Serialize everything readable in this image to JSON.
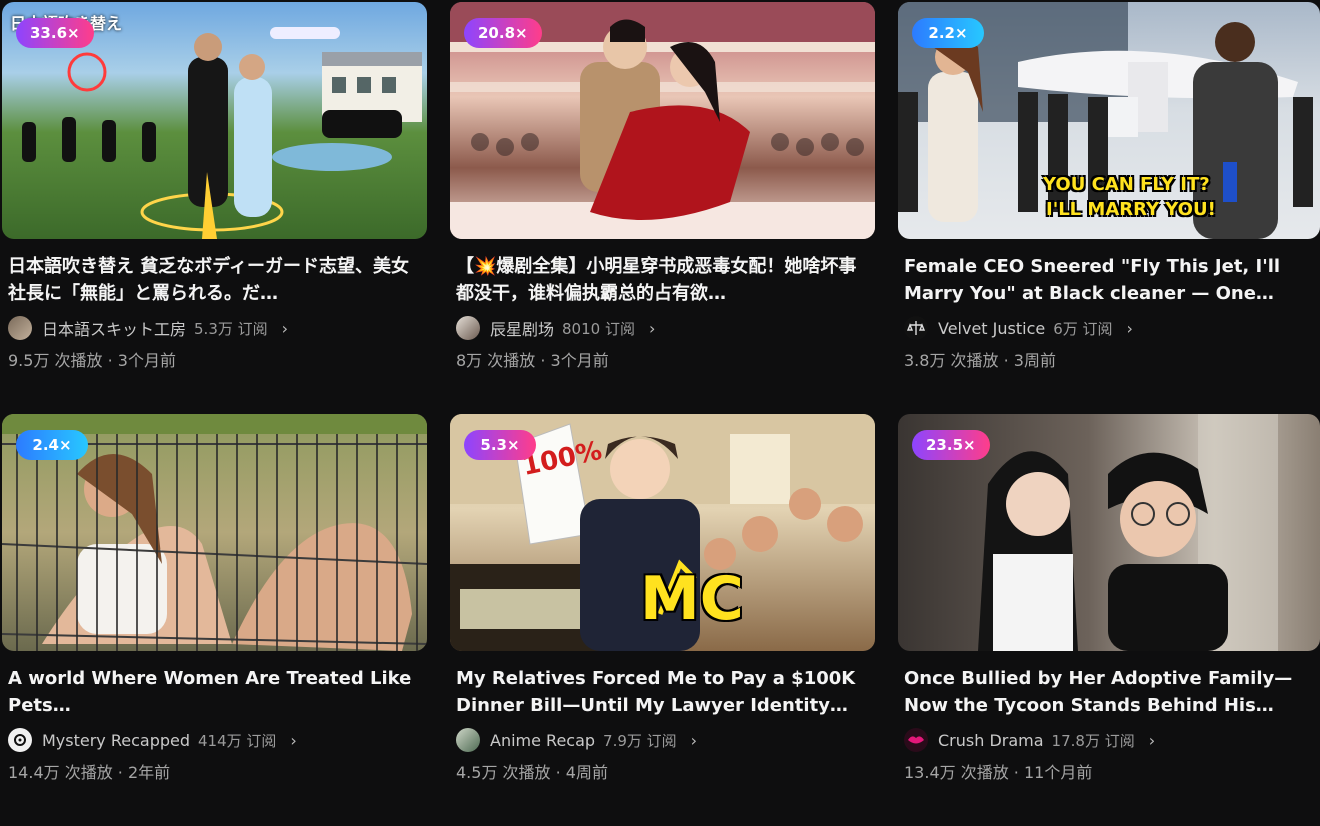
{
  "cards": [
    {
      "badge": "33.6×",
      "badge_style": "pink",
      "watermark": "日本語吹き替え",
      "title": "日本語吹き替え 貧乏なボディーガード志望、美女社長に「無能」と罵られる。だ…",
      "channel": "日本語スキット工房",
      "subs": "5.3万 订阅",
      "stats": "9.5万 次播放 · 3个月前",
      "thumb_icon": "bodyguard-fantasy-thumbnail"
    },
    {
      "badge": "20.8×",
      "badge_style": "pink",
      "title": "【💥爆剧全集】小明星穿书成恶毒女配！她啥坏事都没干，谁料偏执霸总的占有欲…",
      "channel": "辰星剧场",
      "subs": "8010 订阅",
      "stats": "8万 次播放 · 3个月前",
      "thumb_icon": "couple-theater-thumbnail"
    },
    {
      "badge": "2.2×",
      "badge_style": "blue",
      "overlay_text_1": "YOU CAN FLY IT?",
      "overlay_text_2": "I'LL MARRY YOU!",
      "title": "Female CEO Sneered \"Fly This Jet, I'll Marry You\" at Black cleaner — One…",
      "channel": "Velvet Justice",
      "subs": "6万 订阅",
      "stats": "3.8万 次播放 · 3周前",
      "thumb_icon": "private-jet-thumbnail"
    },
    {
      "badge": "2.4×",
      "badge_style": "blue",
      "title": "A world Where Women Are Treated Like Pets…",
      "channel": "Mystery Recapped",
      "subs": "414万 订阅",
      "stats": "14.4万 次播放 · 2年前",
      "thumb_icon": "cage-thumbnail"
    },
    {
      "badge": "5.3×",
      "badge_style": "pink",
      "overlay_text_1": "100%",
      "overlay_text_2": "MC",
      "title": "My Relatives Forced Me to Pay a $100K Dinner Bill—Until My Lawyer Identity…",
      "channel": "Anime Recap",
      "subs": "7.9万 订阅",
      "stats": "4.5万 次播放 · 4周前",
      "thumb_icon": "anime-courtroom-thumbnail"
    },
    {
      "badge": "23.5×",
      "badge_style": "pink",
      "title": "Once Bullied by Her Adoptive Family—Now the Tycoon Stands Behind His…",
      "channel": "Crush Drama",
      "subs": "17.8万 订阅",
      "stats": "13.4万 次播放 · 11个月前",
      "thumb_icon": "couple-portrait-thumbnail"
    }
  ],
  "chevron": "›",
  "colors": {
    "background": "#0e0e0f",
    "badge_pink_from": "#8d45ff",
    "badge_pink_to": "#ff3d8a",
    "badge_blue_from": "#2c7bff",
    "badge_blue_to": "#28c8ff"
  }
}
